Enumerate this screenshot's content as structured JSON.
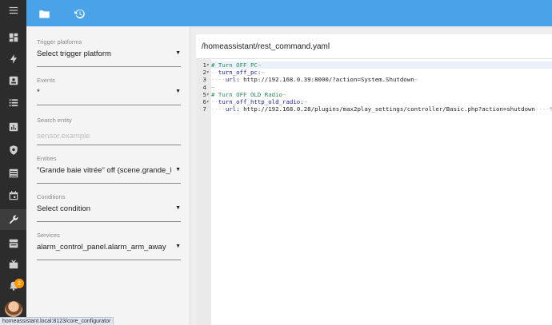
{
  "header": {
    "icons": [
      "folder-icon",
      "history-icon"
    ]
  },
  "sidebar": {
    "items": [
      {
        "icon": "menu-icon"
      },
      {
        "icon": "dashboard-icon"
      },
      {
        "icon": "lightning-icon"
      },
      {
        "icon": "logbook-icon"
      },
      {
        "icon": "list-icon"
      },
      {
        "icon": "chart-icon"
      },
      {
        "icon": "shield-icon"
      },
      {
        "icon": "table-icon"
      },
      {
        "icon": "calendar-icon"
      },
      {
        "icon": "wrench-icon",
        "active": true
      },
      {
        "icon": "hacs-icon"
      },
      {
        "icon": "media-icon"
      },
      {
        "icon": "bell-icon"
      }
    ],
    "notification_count": "2"
  },
  "trigger_panel": {
    "trigger_platforms": {
      "label": "Trigger platforms",
      "value": "Select trigger platform"
    },
    "events": {
      "label": "Events",
      "value": "*"
    },
    "search_entity": {
      "label": "Search entity",
      "placeholder": "sensor.example"
    },
    "entities": {
      "label": "Entities",
      "value": "\"Grande baie vitrée\" off (scene.grande_baie_vitree"
    },
    "conditions": {
      "label": "Conditions",
      "value": "Select condition"
    },
    "services": {
      "label": "Services",
      "value": "alarm_control_panel.alarm_arm_away"
    },
    "dropdown_arrow": "▼"
  },
  "editor": {
    "file_path": "/homeassistant/rest_command.yaml",
    "lines": [
      {
        "num": "1",
        "fold": "▾",
        "segments": [
          {
            "cls": "cmt",
            "text": "# Turn OFF PC"
          },
          {
            "cls": "ws",
            "text": "¬"
          }
        ]
      },
      {
        "num": "2",
        "fold": "▾",
        "segments": [
          {
            "cls": "ws",
            "text": "··"
          },
          {
            "cls": "key",
            "text": "turn_off_pc:"
          },
          {
            "cls": "ws",
            "text": "¬"
          }
        ]
      },
      {
        "num": "3",
        "fold": "",
        "segments": [
          {
            "cls": "ws",
            "text": "····"
          },
          {
            "cls": "key",
            "text": "url:"
          },
          {
            "cls": "val",
            "text": " http://192.168.0.39:8000/?action=System.Shutdown"
          },
          {
            "cls": "ws",
            "text": "¬"
          }
        ]
      },
      {
        "num": "4",
        "fold": "",
        "segments": [
          {
            "cls": "ws",
            "text": "¬"
          }
        ]
      },
      {
        "num": "5",
        "fold": "▾",
        "segments": [
          {
            "cls": "cmt",
            "text": "# Turn OFF OLD Radio"
          },
          {
            "cls": "ws",
            "text": "¬"
          }
        ]
      },
      {
        "num": "6",
        "fold": "▾",
        "segments": [
          {
            "cls": "ws",
            "text": "··"
          },
          {
            "cls": "key",
            "text": "turn_off_http_old_radio:"
          },
          {
            "cls": "ws",
            "text": "¬"
          }
        ]
      },
      {
        "num": "7",
        "fold": "",
        "segments": [
          {
            "cls": "ws",
            "text": "····"
          },
          {
            "cls": "key",
            "text": "url:"
          },
          {
            "cls": "val",
            "text": " http://192.168.0.28/plugins/max2play_settings/controller/Basic.php?action=shutdown"
          },
          {
            "cls": "ws",
            "text": "····¶"
          }
        ]
      }
    ]
  },
  "status_url": "homeassistant.local:8123/core_configurator"
}
